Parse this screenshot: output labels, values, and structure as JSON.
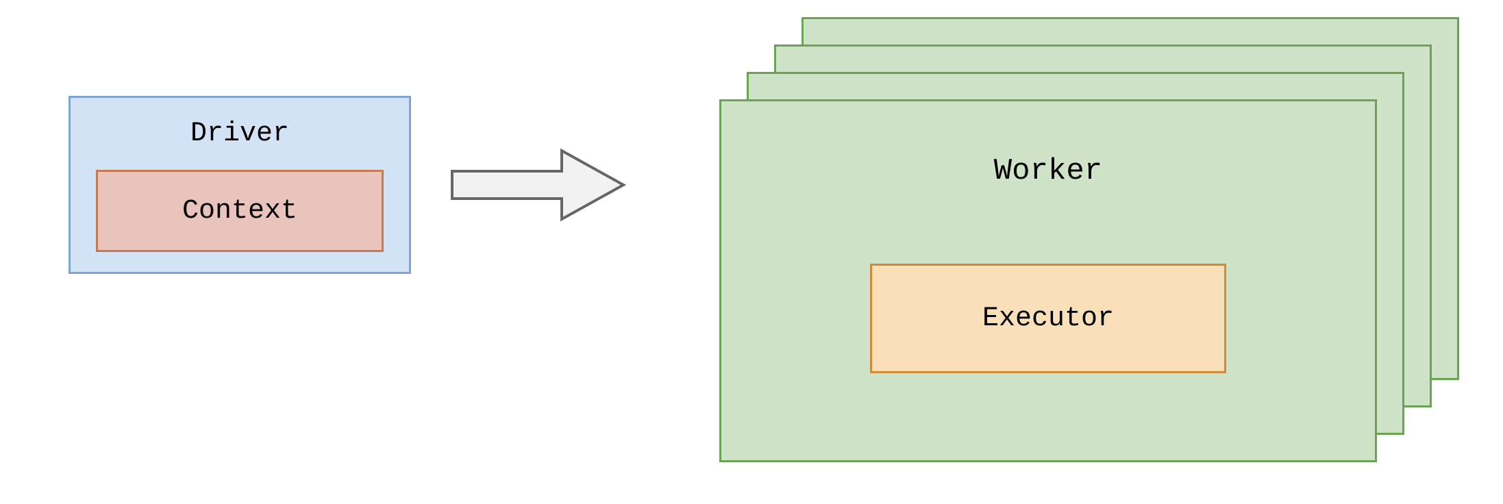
{
  "driver": {
    "title": "Driver",
    "context": {
      "title": "Context"
    }
  },
  "worker": {
    "title": "Worker",
    "executor": {
      "title": "Executor"
    }
  },
  "colors": {
    "driver_fill": "#d3e3f6",
    "driver_border": "#7ea3d4",
    "context_fill": "#e9c4bd",
    "context_border": "#c77a4f",
    "worker_fill": "#cee3c7",
    "worker_border": "#6aa353",
    "executor_fill": "#f9e0b9",
    "executor_border": "#d28a3a",
    "arrow_fill": "#f2f2f2",
    "arrow_border": "#666666"
  }
}
